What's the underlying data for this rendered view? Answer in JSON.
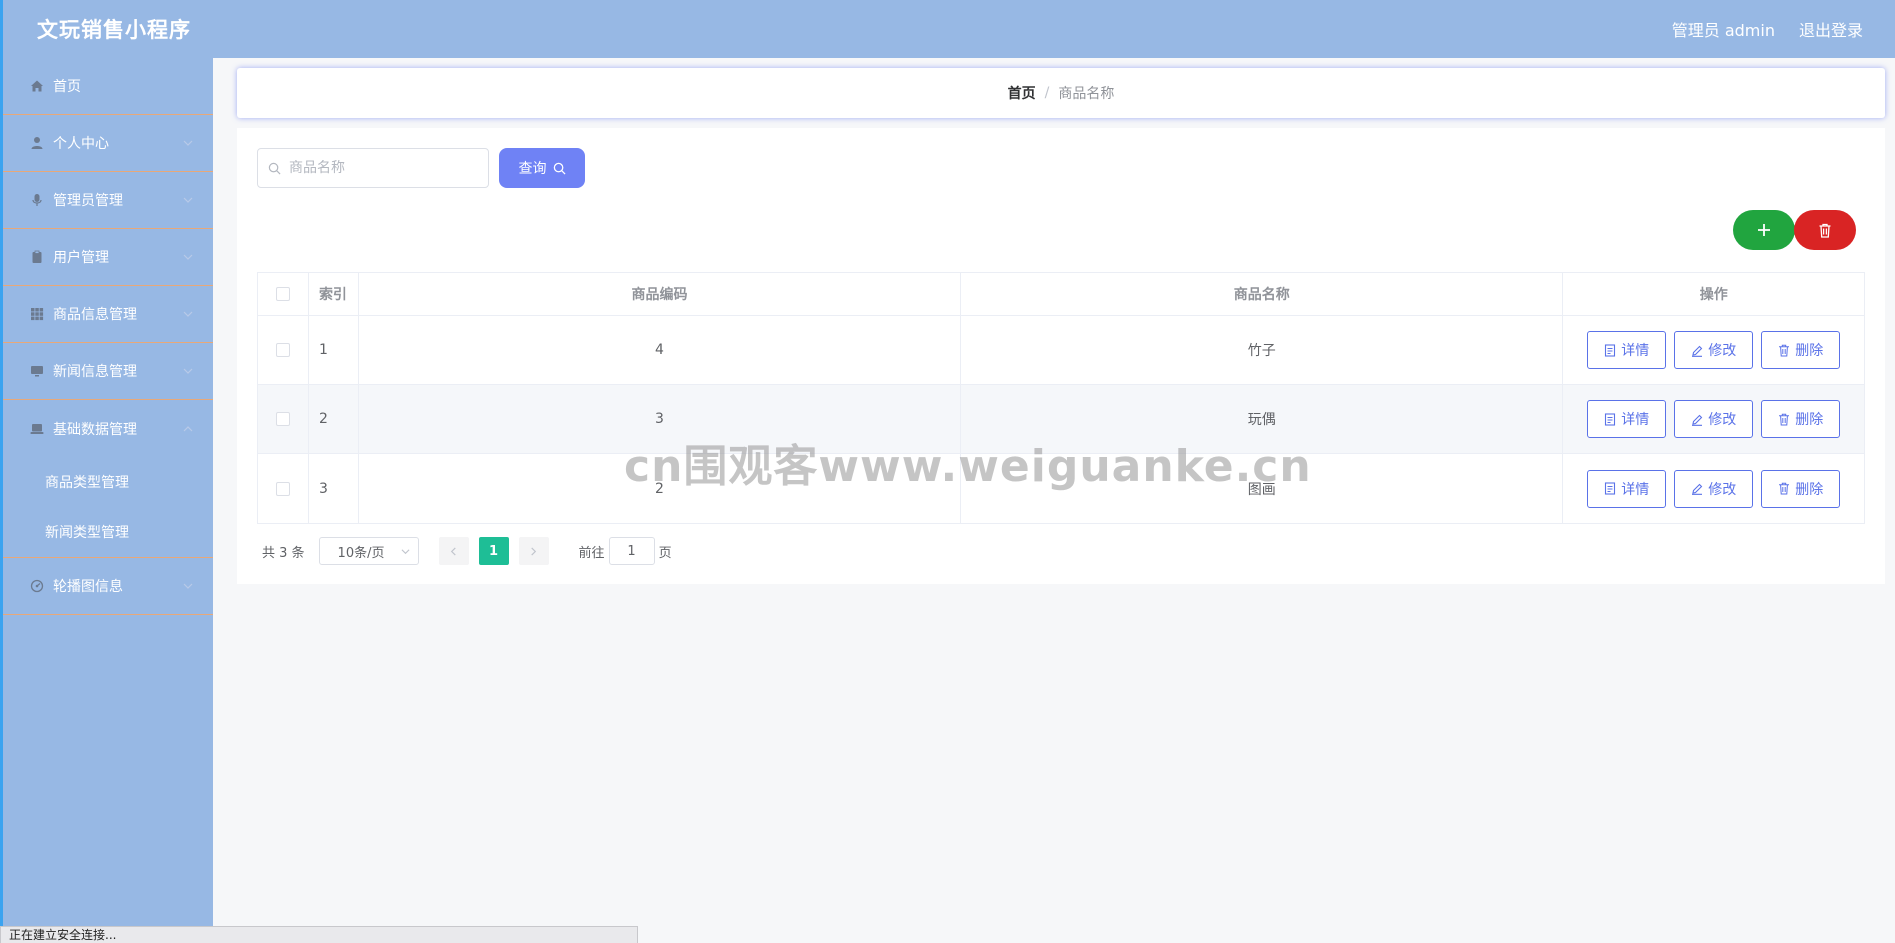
{
  "header": {
    "app_title": "文玩销售小程序",
    "admin_label": "管理员 admin",
    "logout_label": "退出登录"
  },
  "sidebar": {
    "items": [
      {
        "label": "首页",
        "icon": "home-icon"
      },
      {
        "label": "个人中心",
        "icon": "user-icon"
      },
      {
        "label": "管理员管理",
        "icon": "microphone-icon"
      },
      {
        "label": "用户管理",
        "icon": "clipboard-icon"
      },
      {
        "label": "商品信息管理",
        "icon": "grid-icon"
      },
      {
        "label": "新闻信息管理",
        "icon": "monitor-icon"
      },
      {
        "label": "基础数据管理",
        "icon": "laptop-icon"
      },
      {
        "label": "轮播图信息",
        "icon": "dashboard-icon"
      }
    ],
    "submenu": [
      "商品类型管理",
      "新闻类型管理"
    ]
  },
  "breadcrumb": {
    "home": "首页",
    "separator": "/",
    "current": "商品名称"
  },
  "search": {
    "placeholder": "商品名称",
    "button_label": "查询"
  },
  "table": {
    "headers": [
      "索引",
      "商品编码",
      "商品名称",
      "操作"
    ],
    "rows": [
      {
        "index": "1",
        "code": "4",
        "name": "竹子"
      },
      {
        "index": "2",
        "code": "3",
        "name": "玩偶"
      },
      {
        "index": "3",
        "code": "2",
        "name": "图画"
      }
    ],
    "ops": {
      "detail": "详情",
      "edit": "修改",
      "delete": "删除"
    }
  },
  "pagination": {
    "total": "共 3 条",
    "page_size": "10条/页",
    "current_page": "1",
    "goto_prefix": "前往",
    "goto_value": "1",
    "goto_suffix": "页"
  },
  "watermark": "cn围观客www.weiguanke.cn",
  "status_bar": "正在建立安全连接..."
}
